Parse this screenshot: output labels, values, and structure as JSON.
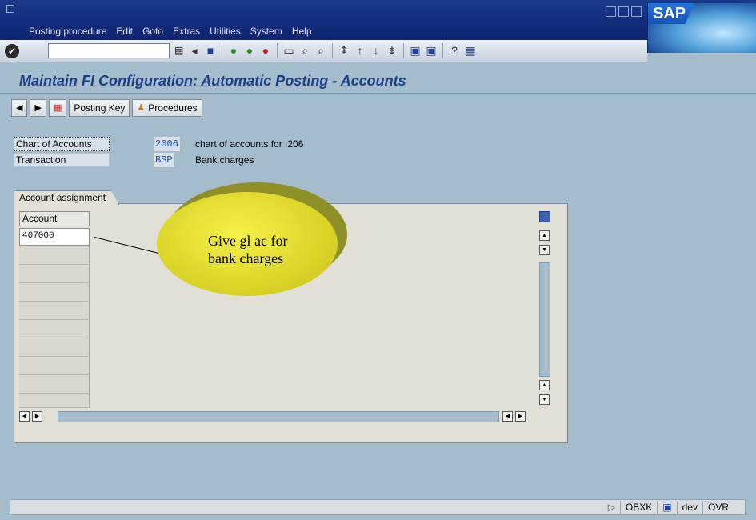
{
  "menu": [
    "Posting procedure",
    "Edit",
    "Goto",
    "Extras",
    "Utilities",
    "System",
    "Help"
  ],
  "logo": "SAP",
  "title": "Maintain FI Configuration: Automatic Posting - Accounts",
  "app_toolbar": {
    "posting_key": "Posting Key",
    "procedures": "Procedures"
  },
  "header": {
    "coa_label": "Chart of Accounts",
    "coa_value": "2006",
    "coa_desc": "chart of accounts for :206",
    "txn_label": "Transaction",
    "txn_value": "BSP",
    "txn_desc": "Bank charges"
  },
  "tab": {
    "label": "Account assignment"
  },
  "grid": {
    "column": "Account",
    "rows": [
      "407000"
    ]
  },
  "callout": {
    "line1": "Give gl ac for",
    "line2": "bank charges"
  },
  "status": {
    "tcode": "OBXK",
    "system": "dev",
    "mode": "OVR"
  },
  "colors": {
    "title_blue": "#1c3f86",
    "callout_yellow": "#e3dc2e"
  }
}
